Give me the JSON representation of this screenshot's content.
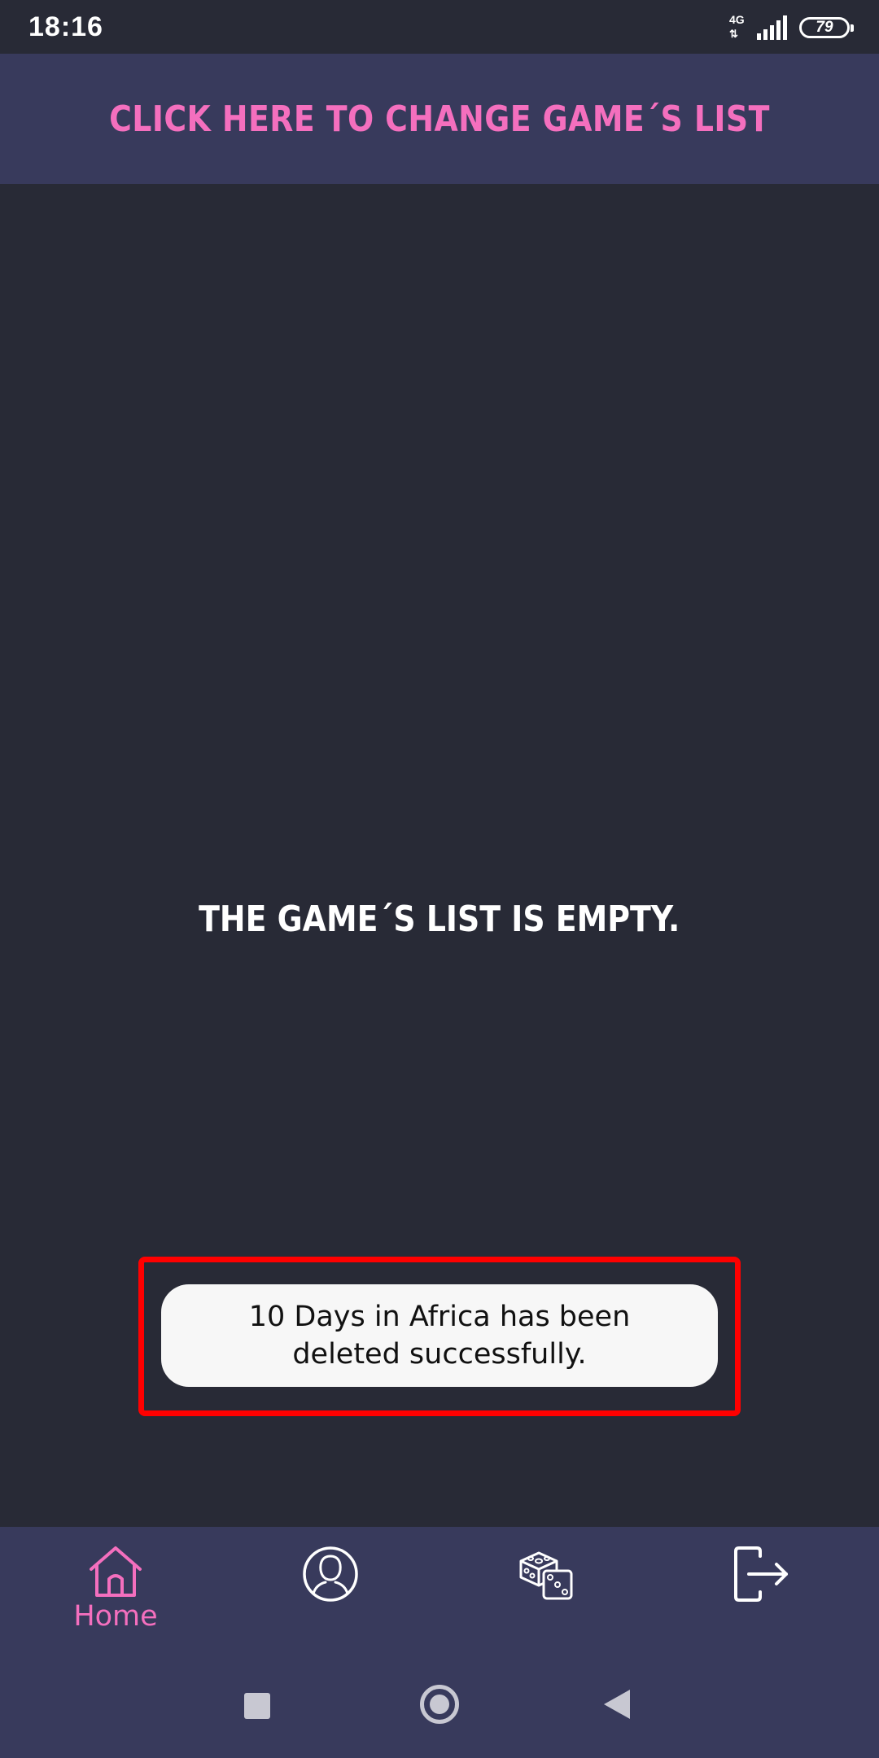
{
  "status_bar": {
    "time": "18:16",
    "network_type": "4G",
    "battery_level": "79"
  },
  "banner": {
    "label": "CLICK HERE TO CHANGE GAME´S LIST"
  },
  "main": {
    "empty_message": "THE GAME´S LIST IS EMPTY."
  },
  "toast": {
    "message": "10 Days in Africa has been deleted successfully."
  },
  "bottom_nav": {
    "items": [
      {
        "icon": "home-icon",
        "label": "Home",
        "active": true
      },
      {
        "icon": "profile-icon",
        "label": "",
        "active": false
      },
      {
        "icon": "dice-icon",
        "label": "",
        "active": false
      },
      {
        "icon": "logout-icon",
        "label": "",
        "active": false
      }
    ]
  },
  "system_nav": {
    "buttons": [
      "recents",
      "home",
      "back"
    ]
  },
  "colors": {
    "background": "#282a36",
    "bar_background": "#383a5c",
    "accent_pink": "#f46fbe",
    "highlight_red": "#ff0000",
    "toast_background": "#f7f7f7"
  }
}
